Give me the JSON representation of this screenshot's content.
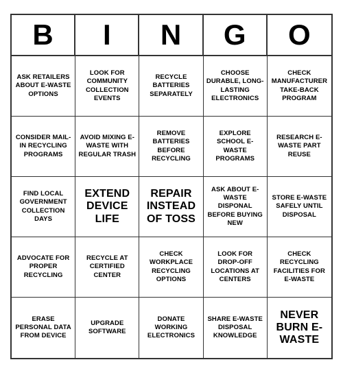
{
  "header": {
    "letters": [
      "B",
      "I",
      "N",
      "G",
      "O"
    ]
  },
  "cells": [
    {
      "text": "ASK RETAILERS ABOUT E-WASTE OPTIONS",
      "size": "normal"
    },
    {
      "text": "LOOK FOR COMMUNITY COLLECTION EVENTS",
      "size": "normal"
    },
    {
      "text": "RECYCLE BATTERIES SEPARATELY",
      "size": "normal"
    },
    {
      "text": "CHOOSE DURABLE, LONG-LASTING ELECTRONICS",
      "size": "normal"
    },
    {
      "text": "CHECK MANUFACTURER TAKE-BACK PROGRAM",
      "size": "normal"
    },
    {
      "text": "CONSIDER MAIL-IN RECYCLING PROGRAMS",
      "size": "normal"
    },
    {
      "text": "AVOID MIXING E-WASTE WITH REGULAR TRASH",
      "size": "normal"
    },
    {
      "text": "REMOVE BATTERIES BEFORE RECYCLING",
      "size": "normal"
    },
    {
      "text": "EXPLORE SCHOOL E-WASTE PROGRAMS",
      "size": "normal"
    },
    {
      "text": "RESEARCH E-WASTE PART REUSE",
      "size": "normal"
    },
    {
      "text": "FIND LOCAL GOVERNMENT COLLECTION DAYS",
      "size": "normal"
    },
    {
      "text": "EXTEND DEVICE LIFE",
      "size": "large"
    },
    {
      "text": "REPAIR INSTEAD OF TOSS",
      "size": "large"
    },
    {
      "text": "ASK ABOUT E-WASTE DISPONAL BEFORE BUYING NEW",
      "size": "normal"
    },
    {
      "text": "STORE E-WASTE SAFELY UNTIL DISPOSAL",
      "size": "normal"
    },
    {
      "text": "ADVOCATE FOR PROPER RECYCLING",
      "size": "normal"
    },
    {
      "text": "RECYCLE AT CERTIFIED CENTER",
      "size": "normal"
    },
    {
      "text": "CHECK WORKPLACE RECYCLING OPTIONS",
      "size": "normal"
    },
    {
      "text": "LOOK FOR DROP-OFF LOCATIONS AT CENTERS",
      "size": "normal"
    },
    {
      "text": "CHECK RECYCLING FACILITIES FOR E-WASTE",
      "size": "normal"
    },
    {
      "text": "ERASE PERSONAL DATA FROM DEVICE",
      "size": "normal"
    },
    {
      "text": "UPGRADE SOFTWARE",
      "size": "normal"
    },
    {
      "text": "DONATE WORKING ELECTRONICS",
      "size": "normal"
    },
    {
      "text": "SHARE E-WASTE DISPOSAL KNOWLEDGE",
      "size": "normal"
    },
    {
      "text": "NEVER BURN E-WASTE",
      "size": "large"
    }
  ]
}
